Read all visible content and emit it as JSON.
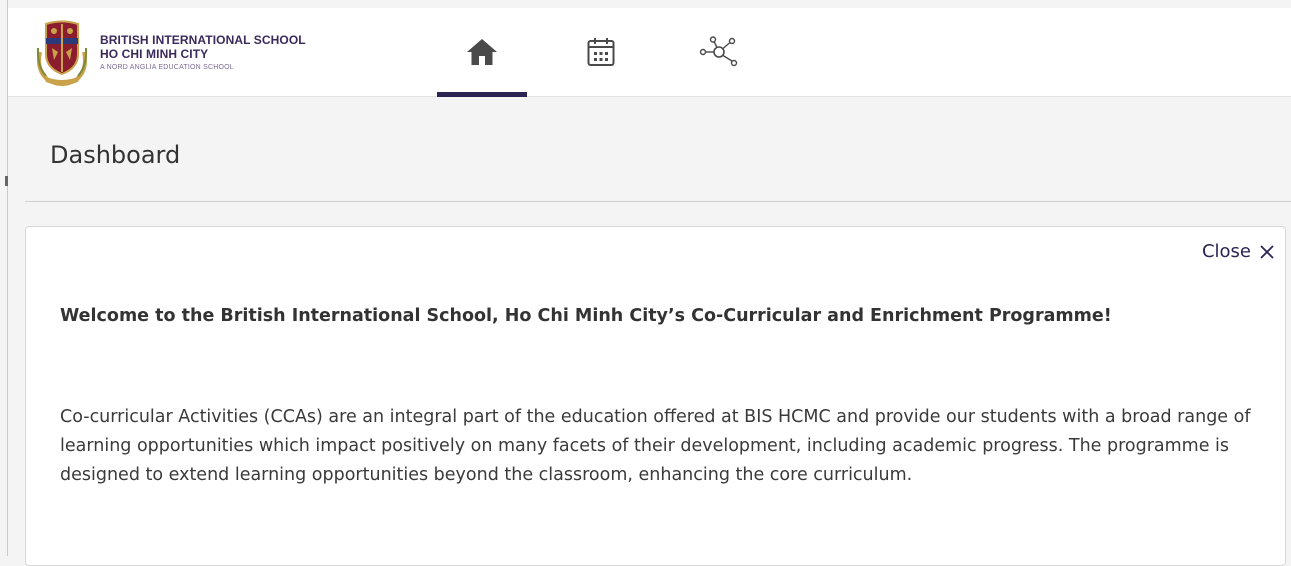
{
  "brand": {
    "line1": "BRITISH INTERNATIONAL SCHOOL",
    "line2": "HO CHI MINH CITY",
    "line3": "A NORD ANGLIA EDUCATION SCHOOL",
    "logo_icon": "school-crest-icon"
  },
  "nav": {
    "tabs": [
      {
        "icon": "home-icon",
        "active": true
      },
      {
        "icon": "calendar-icon",
        "active": false
      },
      {
        "icon": "network-icon",
        "active": false
      }
    ]
  },
  "page": {
    "title": "Dashboard"
  },
  "card": {
    "close_label": "Close",
    "close_icon": "close-icon",
    "welcome": "Welcome to the British International School, Ho Chi Minh City’s Co-Curricular and Enrichment Programme!",
    "intro": "Co-curricular Activities (CCAs) are an integral part of the education offered at BIS HCMC and provide our students with a broad range of learning opportunities which impact positively on many facets of their development, including academic progress. The programme is designed to extend learning opportunities beyond the classroom, enhancing the core curriculum."
  },
  "colors": {
    "accent": "#2b2453",
    "icon": "#4a4a4a",
    "background": "#f4f4f4"
  }
}
